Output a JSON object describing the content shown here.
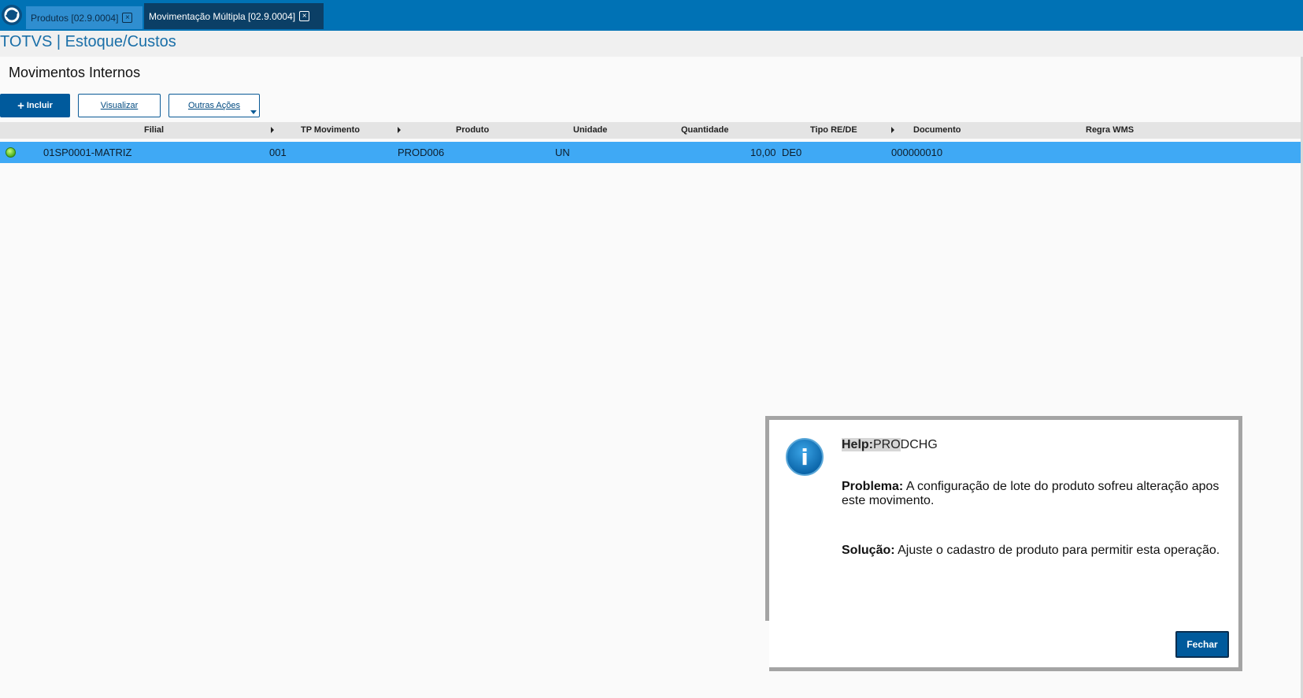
{
  "tabs": [
    {
      "label": "Produtos [02.9.0004]"
    },
    {
      "label": "Movimentação Múltipla [02.9.0004]"
    }
  ],
  "brand": "TOTVS | Estoque/Custos",
  "page_title": "Movimentos Internos",
  "toolbar": {
    "include_label": "Incluir",
    "view_label": "Visualizar",
    "more_label": "Outras Ações"
  },
  "grid": {
    "headers": [
      "Filial",
      "TP Movimento",
      "Produto",
      "Unidade",
      "Quantidade",
      "Tipo RE/DE",
      "Documento",
      "Regra WMS"
    ],
    "rows": [
      {
        "filial": "01SP0001-MATRIZ",
        "tp_movimento": "001",
        "produto": "PROD006",
        "unidade": "UN",
        "quantidade": "10,00",
        "tipo": "DE0",
        "documento": "000000010",
        "regra_wms": ""
      }
    ]
  },
  "dialog": {
    "help_label": "Help:",
    "help_code_highlight": "PRO",
    "help_code_rest": "DCHG",
    "problem_label": "Problema:",
    "problem_text": " A configuração de lote do produto sofreu alteração apos este movimento.",
    "solution_label": "Solução:",
    "solution_text": " Ajuste o cadastro de produto para permitir esta operação.",
    "close_label": "Fechar"
  },
  "colors": {
    "topbar": "#0072b5",
    "selected_row": "#3fa9f5",
    "primary_button": "#005a9c"
  }
}
